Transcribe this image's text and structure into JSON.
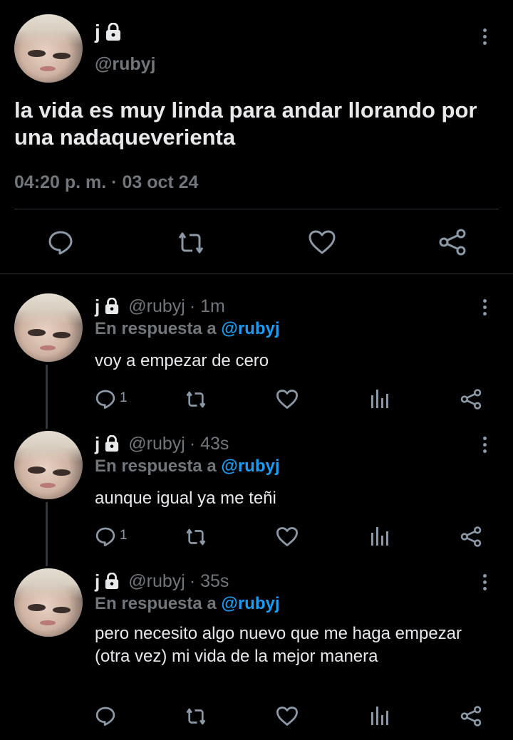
{
  "main_tweet": {
    "name": "j",
    "handle": "@rubyj",
    "text": "la vida es muy linda para andar llorando por una nadaqueverienta",
    "timestamp": "04:20 p. m. · 03 oct 24"
  },
  "replies": [
    {
      "name": "j",
      "handle": "@rubyj",
      "time": "· 1m",
      "reply_prefix": "En respuesta a",
      "reply_handle": "@rubyj",
      "text": "voy a empezar de cero",
      "reply_count": "1"
    },
    {
      "name": "j",
      "handle": "@rubyj",
      "time": "· 43s",
      "reply_prefix": "En respuesta a",
      "reply_handle": "@rubyj",
      "text": "aunque igual ya me teñi",
      "reply_count": "1"
    },
    {
      "name": "j",
      "handle": "@rubyj",
      "time": "· 35s",
      "reply_prefix": "En respuesta a",
      "reply_handle": "@rubyj",
      "text": "pero necesito algo nuevo que me haga empezar (otra vez) mi vida de la mejor manera",
      "reply_count": ""
    }
  ],
  "icons": {
    "reply": "reply-bubble-icon",
    "retweet": "retweet-icon",
    "like": "heart-icon",
    "views": "views-bars-icon",
    "share": "share-icon",
    "more": "more-vertical-icon",
    "lock": "lock-icon"
  },
  "colors": {
    "background": "#000000",
    "text": "#e7e9ea",
    "muted": "#71767b",
    "accent": "#1d9bf0"
  }
}
